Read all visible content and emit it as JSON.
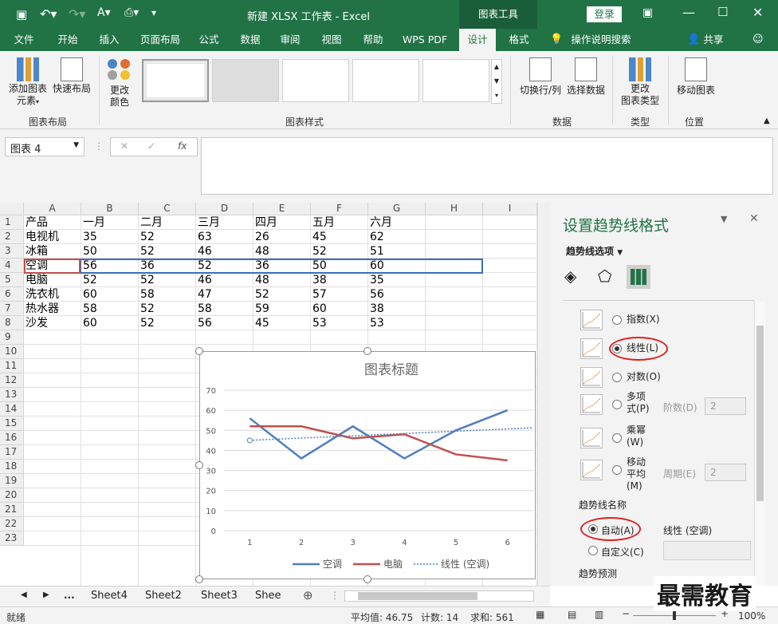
{
  "titlebar": {
    "title": "新建 XLSX 工作表  -  Excel",
    "context_tab": "图表工具",
    "login": "登录"
  },
  "tabs": [
    "文件",
    "开始",
    "插入",
    "页面布局",
    "公式",
    "数据",
    "审阅",
    "视图",
    "帮助",
    "WPS PDF",
    "设计",
    "格式"
  ],
  "tell_me": "操作说明搜索",
  "share": "共享",
  "ribbon": {
    "add_element": "添加图表\n元素",
    "quick_layout": "快速布局",
    "change_colors": "更改\n颜色",
    "group_layout": "图表布局",
    "group_styles": "图表样式",
    "switch_rowcol": "切换行/列",
    "select_data": "选择数据",
    "group_data": "数据",
    "change_type": "更改\n图表类型",
    "group_type": "类型",
    "move_chart": "移动图表",
    "group_location": "位置"
  },
  "formula_bar": {
    "name_box": "图表 4",
    "fx": "fx"
  },
  "sheet": {
    "columns": [
      "A",
      "B",
      "C",
      "D",
      "E",
      "F",
      "G",
      "H",
      "I"
    ],
    "rows": [
      "1",
      "2",
      "3",
      "4",
      "5",
      "6",
      "7",
      "8",
      "9",
      "10",
      "11",
      "12",
      "13",
      "14",
      "15",
      "16",
      "17",
      "18",
      "19",
      "20",
      "21",
      "22",
      "23"
    ],
    "data": [
      [
        "产品",
        "一月",
        "二月",
        "三月",
        "四月",
        "五月",
        "六月"
      ],
      [
        "电视机",
        "35",
        "52",
        "63",
        "26",
        "45",
        "62"
      ],
      [
        "冰箱",
        "50",
        "52",
        "46",
        "48",
        "52",
        "51"
      ],
      [
        "空调",
        "56",
        "36",
        "52",
        "36",
        "50",
        "60"
      ],
      [
        "电脑",
        "52",
        "52",
        "46",
        "48",
        "38",
        "35"
      ],
      [
        "洗衣机",
        "60",
        "58",
        "47",
        "52",
        "57",
        "56"
      ],
      [
        "热水器",
        "58",
        "52",
        "58",
        "59",
        "60",
        "38"
      ],
      [
        "沙发",
        "60",
        "52",
        "56",
        "45",
        "53",
        "53"
      ]
    ]
  },
  "chart_data": {
    "type": "line",
    "title": "图表标题",
    "categories": [
      "1",
      "2",
      "3",
      "4",
      "5",
      "6"
    ],
    "ylim": [
      0,
      70
    ],
    "yticks": [
      "0",
      "10",
      "20",
      "30",
      "40",
      "50",
      "60",
      "70"
    ],
    "series": [
      {
        "name": "空调",
        "values": [
          56,
          36,
          52,
          36,
          50,
          60
        ],
        "color": "#4f7fbf"
      },
      {
        "name": "电脑",
        "values": [
          52,
          52,
          46,
          48,
          38,
          35
        ],
        "color": "#c0504d"
      }
    ],
    "trendline": {
      "name": "线性 (空调)",
      "values": [
        45,
        46.1,
        47.3,
        48.4,
        49.6,
        50.7
      ],
      "color": "#4f7fbf"
    },
    "legend_position": "bottom",
    "grid": true
  },
  "pane": {
    "title": "设置趋势线格式",
    "options_label": "趋势线选项",
    "types": [
      {
        "label": "指数(X)",
        "checked": false
      },
      {
        "label": "线性(L)",
        "checked": true
      },
      {
        "label": "对数(O)",
        "checked": false
      },
      {
        "label": "多项\n式(P)",
        "checked": false
      },
      {
        "label": "乘幂\n(W)",
        "checked": false
      },
      {
        "label": "移动\n平均\n(M)",
        "checked": false
      }
    ],
    "order_label": "阶数(D)",
    "order_value": "2",
    "period_label": "周期(E)",
    "period_value": "2",
    "name_section": "趋势线名称",
    "auto_label": "自动(A)",
    "auto_value": "线性 (空调)",
    "custom_label": "自定义(C)",
    "forecast_section": "趋势预测"
  },
  "sheet_tabs": [
    "...",
    "Sheet4",
    "Sheet2",
    "Sheet3",
    "Shee"
  ],
  "status": {
    "ready": "就绪",
    "average": "平均值: 46.75",
    "count": "计数: 14",
    "sum": "求和: 561",
    "zoom": "100%"
  },
  "watermark": "最需教育"
}
